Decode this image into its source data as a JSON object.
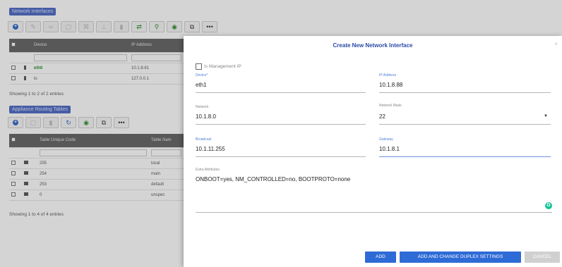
{
  "bg": {
    "section1_title": "Network Interfaces",
    "table1": {
      "headers": [
        "Device",
        "IP Address"
      ],
      "rows": [
        {
          "device": "eth0",
          "ip": "10.1.8.81"
        },
        {
          "device": "lo",
          "ip": "127.0.0.1"
        }
      ],
      "showing": "Showing 1 to 2 of 2 entries"
    },
    "section2_title": "Appliance Routing Tables",
    "table2": {
      "headers": [
        "Table Unique Code",
        "Table Nam"
      ],
      "rows": [
        {
          "code": "255",
          "name": "local"
        },
        {
          "code": "254",
          "name": "main"
        },
        {
          "code": "253",
          "name": "default"
        },
        {
          "code": "0",
          "name": "unspec"
        }
      ],
      "showing": "Showing 1 to 4 of 4 entries"
    }
  },
  "modal": {
    "title": "Create New Network Interface",
    "close": "×",
    "mgmt_label": "Is Management IP",
    "device": {
      "label": "Device*",
      "value": "eth1"
    },
    "ip_address": {
      "label": "IP Address",
      "value": "10.1.8.88"
    },
    "network": {
      "label": "Network",
      "value": "10.1.8.0"
    },
    "network_mask": {
      "label": "Network Mask",
      "value": "22"
    },
    "broadcast": {
      "label": "Broadcast",
      "value": "10.1.11.255"
    },
    "gateway": {
      "label": "Gateway",
      "value": "10.1.8.1"
    },
    "extra": {
      "label": "Extra Attributes",
      "value": "ONBOOT=yes, NM_CONTROLLED=no, BOOTPROTO=none"
    },
    "buttons": {
      "add": "ADD",
      "add_duplex": "ADD AND CHANGE DUPLEX SETTINGS",
      "cancel": "CANCEL"
    }
  },
  "colors": {
    "accent": "#2e6bd6",
    "title": "#2b4aa6",
    "label_blue": "#4f7fd6",
    "grammarly": "#15c39a"
  }
}
